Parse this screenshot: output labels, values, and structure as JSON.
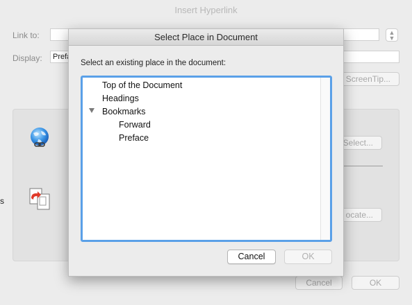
{
  "background_window": {
    "title": "Insert Hyperlink",
    "link_to_label": "Link to:",
    "display_label": "Display:",
    "display_value": "Prefa",
    "screentip_button": "ScreenTip...",
    "select_button": "Select...",
    "locate_button": "ocate...",
    "cancel_button": "Cancel",
    "ok_button": "OK",
    "side_fragment": "s"
  },
  "dialog": {
    "title": "Select Place in Document",
    "instruction": "Select an existing place in the document:",
    "tree": {
      "top_of_document": "Top of the Document",
      "headings": "Headings",
      "bookmarks": "Bookmarks",
      "bookmark_items": [
        "Forward",
        "Preface"
      ]
    },
    "cancel_button": "Cancel",
    "ok_button": "OK"
  },
  "colors": {
    "focus_ring": "#5aa0e8",
    "edge_cyan": "#18b9d6",
    "edge_magenta": "#e0208a"
  },
  "icons": [
    "globe-link-icon",
    "document-link-icon",
    "chevron-down-icon",
    "disclosure-triangle-icon"
  ]
}
